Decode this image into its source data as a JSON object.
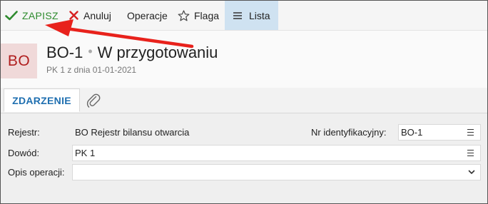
{
  "toolbar": {
    "save_label": "ZAPISZ",
    "cancel_label": "Anuluj",
    "operations_label": "Operacje",
    "flag_label": "Flaga",
    "list_label": "Lista"
  },
  "icons": {
    "save": "check-icon",
    "cancel": "x-icon",
    "flag": "star-icon",
    "list": "hamburger-icon",
    "attachment": "paperclip-icon",
    "lookup": "menu-icon",
    "dropdown": "chevron-down-icon"
  },
  "colors": {
    "save": "#2e8b2e",
    "cancel": "#d62020",
    "accent": "#1f6fb0",
    "list_active_bg": "#cfe2f1",
    "avatar_bg": "#f0d9d9",
    "avatar_text": "#b01e1e",
    "annotation_arrow": "#e8221c"
  },
  "header": {
    "avatar": "BO",
    "doc_number": "BO-1",
    "separator": "•",
    "status": "W przygotowaniu",
    "subtitle": "PK 1 z dnia 01-01-2021"
  },
  "tabs": {
    "main_label": "ZDARZENIE"
  },
  "form": {
    "register_label": "Rejestr:",
    "register_value": "BO Rejestr bilansu otwarcia",
    "id_label": "Nr identyfikacyjny:",
    "id_value": "BO-1",
    "proof_label": "Dowód:",
    "proof_value": "PK 1",
    "description_label": "Opis operacji:",
    "description_value": ""
  }
}
